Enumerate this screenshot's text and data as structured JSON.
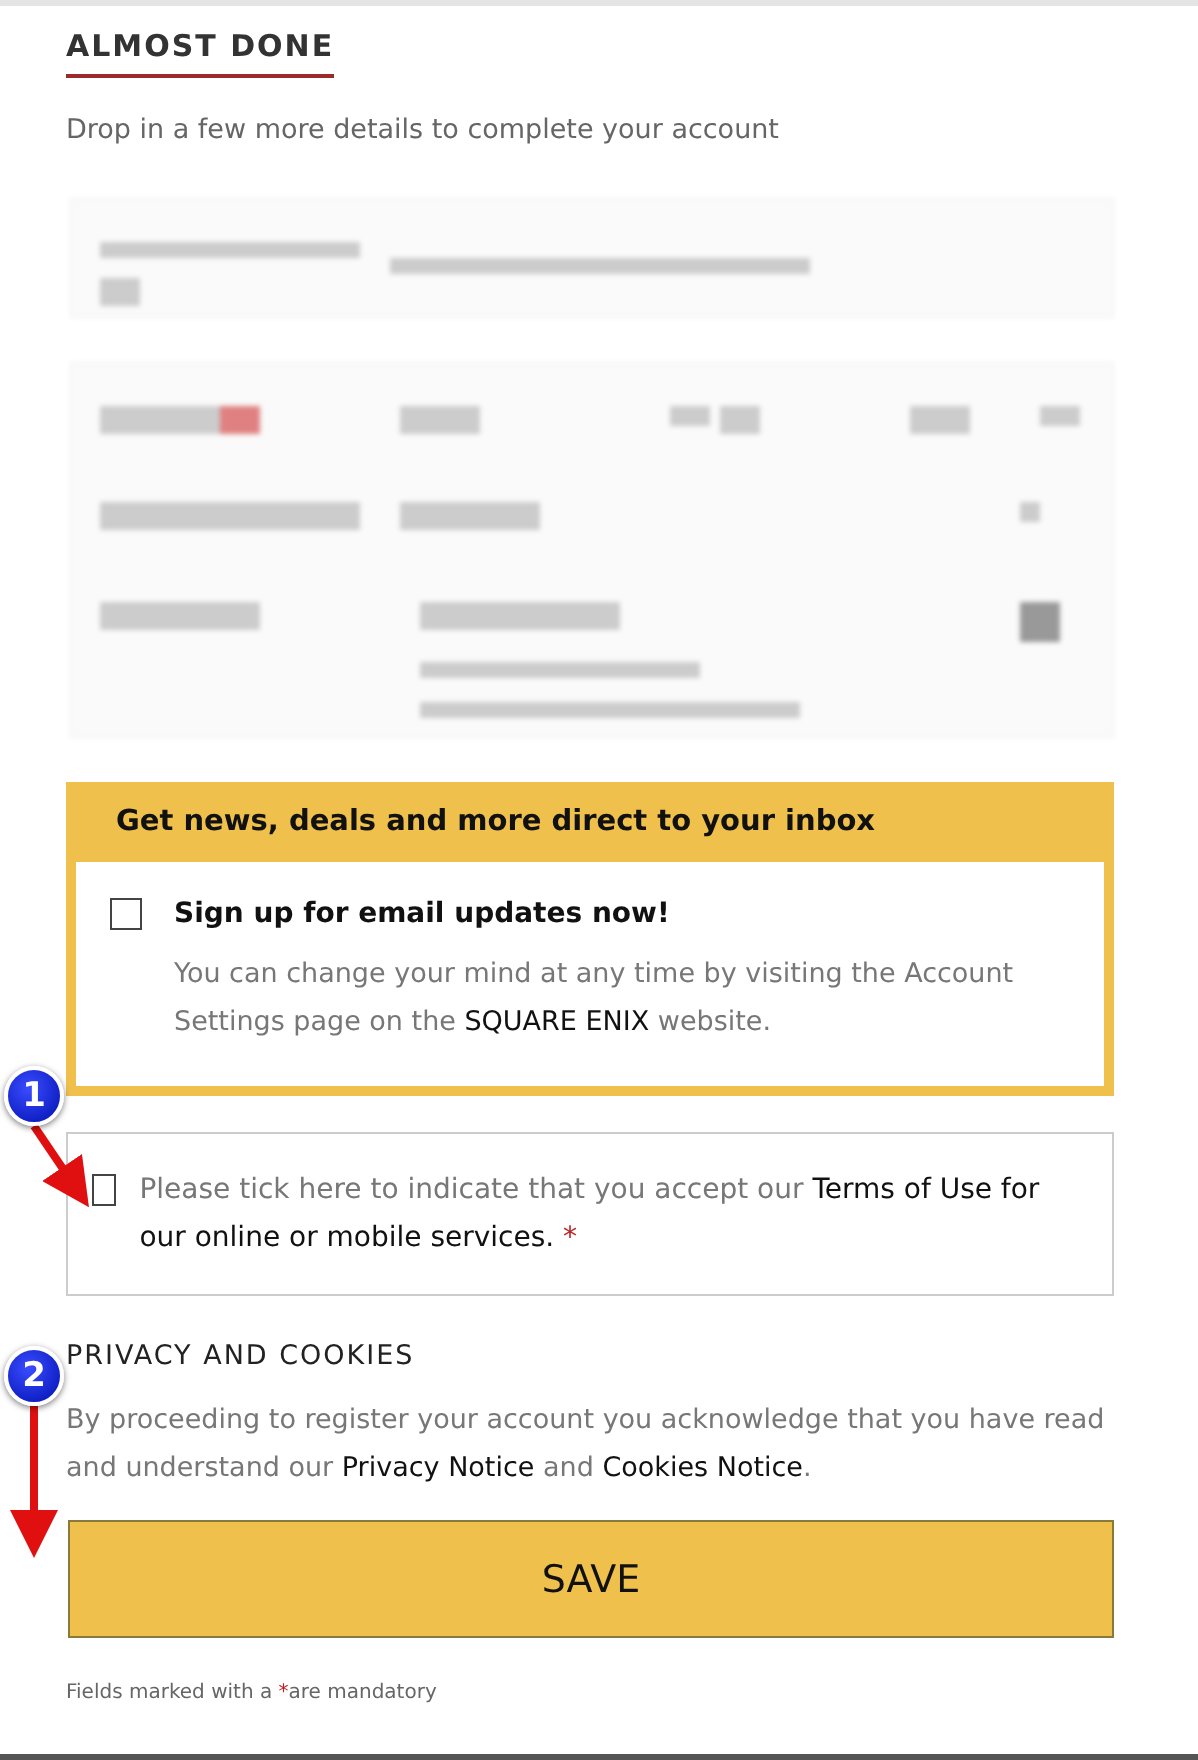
{
  "section": {
    "title": "ALMOST DONE",
    "subtitle": "Drop in a few more details to complete your account"
  },
  "newsletter": {
    "heading": "Get news, deals and more direct to your inbox",
    "checkbox": {
      "label": "Sign up for email updates now!",
      "checked": false
    },
    "note": [
      {
        "kind": "plain",
        "text": "You can change your mind at any time by visiting the Account Settings page on the "
      },
      {
        "kind": "emphasis",
        "text": "SQUARE ENIX"
      },
      {
        "kind": "plain",
        "text": " website."
      }
    ]
  },
  "terms": {
    "checked": false,
    "text": [
      {
        "kind": "plain",
        "text": "Please tick here to indicate that you accept our "
      },
      {
        "kind": "emphasis",
        "text": "Terms of Use for our online or mobile services."
      },
      {
        "kind": "required",
        "text": " *"
      }
    ]
  },
  "privacy": {
    "heading": "PRIVACY AND COOKIES",
    "text": [
      {
        "kind": "plain",
        "text": "By proceeding to register your account you acknowledge that you have read and understand our "
      },
      {
        "kind": "emphasis",
        "text": "Privacy Notice"
      },
      {
        "kind": "plain",
        "text": " and "
      },
      {
        "kind": "emphasis",
        "text": "Cookies Notice"
      },
      {
        "kind": "plain",
        "text": "."
      }
    ]
  },
  "save_button": "SAVE",
  "footnote": [
    {
      "kind": "plain",
      "text": "Fields marked with a "
    },
    {
      "kind": "required",
      "text": "*"
    },
    {
      "kind": "plain",
      "text": "are mandatory"
    }
  ],
  "annotations": [
    {
      "label": "1"
    },
    {
      "label": "2"
    }
  ]
}
